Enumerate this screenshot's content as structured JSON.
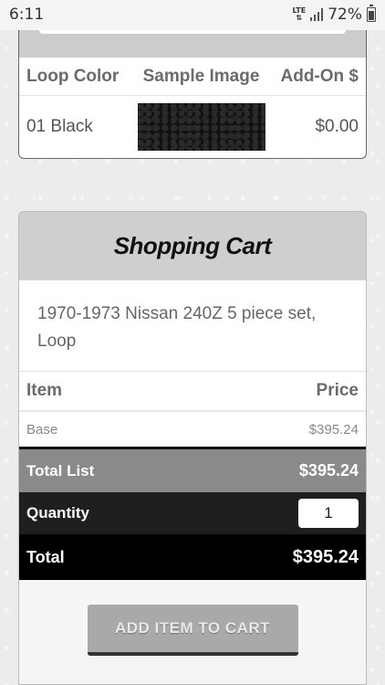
{
  "status_bar": {
    "time": "6:11",
    "network": "LTE",
    "battery": "72%",
    "battery_level": 0.72
  },
  "loop_table": {
    "headers": [
      "Loop Color",
      "Sample Image",
      "Add-On $"
    ],
    "rows": [
      {
        "color": "01 Black",
        "sample_image": "black-loop-carpet-swatch",
        "addon": "$0.00"
      }
    ]
  },
  "cart": {
    "title": "Shopping Cart",
    "description": "1970-1973 Nissan 240Z 5 piece set, Loop",
    "item_header": "Item",
    "price_header": "Price",
    "lines": [
      {
        "item": "Base",
        "price": "$395.24"
      }
    ],
    "total_list_label": "Total List",
    "total_list_value": "$395.24",
    "quantity_label": "Quantity",
    "quantity_value": "1",
    "total_label": "Total",
    "total_value": "$395.24",
    "add_button_label": "ADD ITEM TO CART"
  },
  "colors": {
    "title_band": "#cfcfcf",
    "total_list_bg": "#8a8a8a",
    "quantity_bg": "#1f1f1f",
    "total_bg": "#000000",
    "button_bg": "#a9a9a9"
  }
}
